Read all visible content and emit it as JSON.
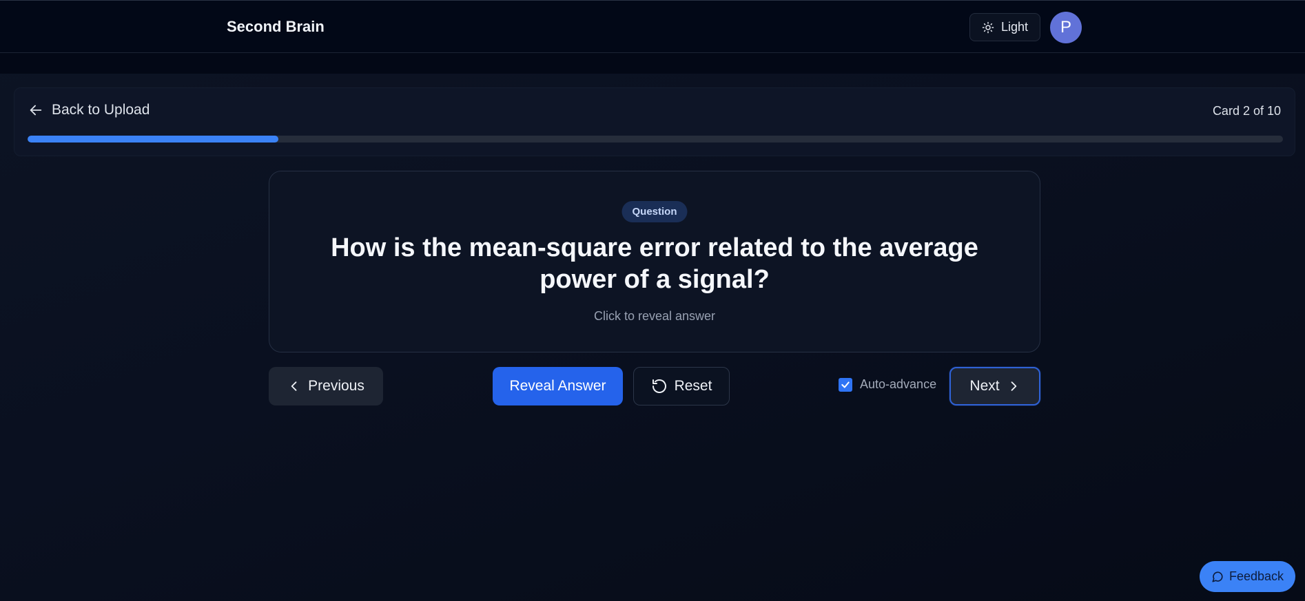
{
  "header": {
    "brand": "Second Brain",
    "theme_label": "Light",
    "avatar_initial": "P"
  },
  "study": {
    "back_label": "Back to Upload",
    "card_count": "Card 2 of 10",
    "progress": 0.2
  },
  "card": {
    "badge": "Question",
    "question": "How is the mean-square error related to the average power of a signal?",
    "hint": "Click to reveal answer"
  },
  "controls": {
    "previous_label": "Previous",
    "reveal_label": "Reveal Answer",
    "reset_label": "Reset",
    "auto_advance_label": "Auto-advance",
    "auto_advance_checked": true,
    "next_label": "Next"
  },
  "feedback_label": "Feedback",
  "colors": {
    "accent": "#3b82f6",
    "primary_button": "#2563eb",
    "avatar": "#6172d8"
  },
  "icons": {
    "theme": "sun-icon",
    "back": "arrow-left-icon",
    "previous": "chevron-left-icon",
    "reset": "rotate-ccw-icon",
    "next": "chevron-right-icon",
    "feedback": "message-circle-icon",
    "check": "check-icon"
  }
}
